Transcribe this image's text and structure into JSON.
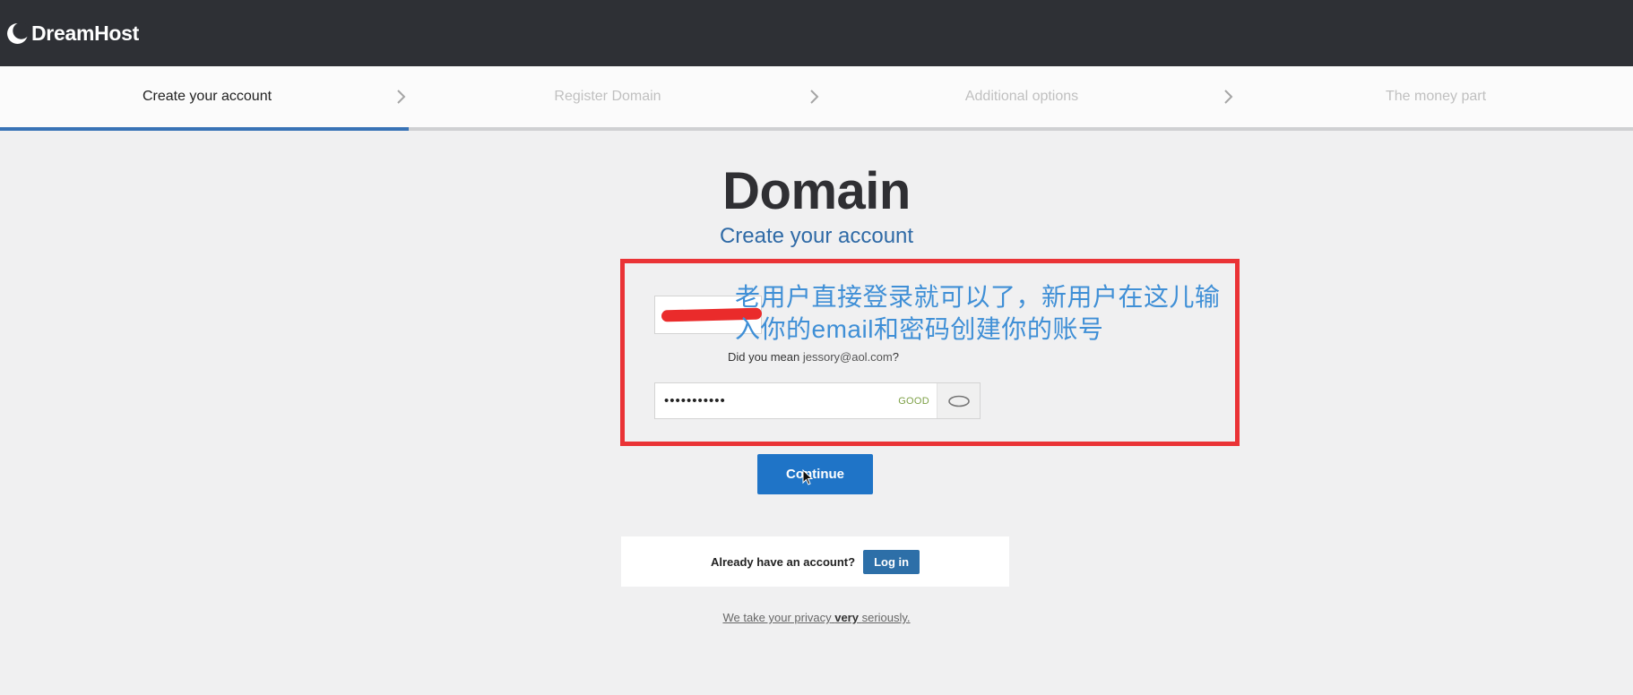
{
  "brand": {
    "name": "DreamHost",
    "icon": "dreamhost-moon-logo"
  },
  "steps": [
    {
      "label": "Create your account",
      "active": true
    },
    {
      "label": "Register Domain",
      "active": false
    },
    {
      "label": "Additional options",
      "active": false
    },
    {
      "label": "The money part",
      "active": false
    }
  ],
  "progress": {
    "completed_fraction": 0.25,
    "color": "#3873b6"
  },
  "page": {
    "title": "Domain",
    "subtitle": "Create your account"
  },
  "annotation": {
    "text": "老用户直接登录就可以了，新用户在这儿输入你的email和密码创建你的账号",
    "color": "#3f8fd6",
    "box_color": "#ea3336"
  },
  "form": {
    "email_suggestion_prefix": "Did you mean",
    "email_suggestion_value": "jessory@aol.com",
    "email_suggestion_suffix": "?",
    "password_value": "•••••••••••",
    "password_strength": "GOOD",
    "show_password_icon": "eye-icon",
    "continue_label": "Continue"
  },
  "login": {
    "question": "Already have an account?",
    "button_label": "Log in"
  },
  "privacy": {
    "prefix": "We take your privacy",
    "emphasis": "very",
    "suffix": "seriously."
  },
  "colors": {
    "topbar": "#2e3035",
    "primary_button": "#1f74c7",
    "login_button": "#2d6fa8",
    "strength_good": "#7da046"
  }
}
